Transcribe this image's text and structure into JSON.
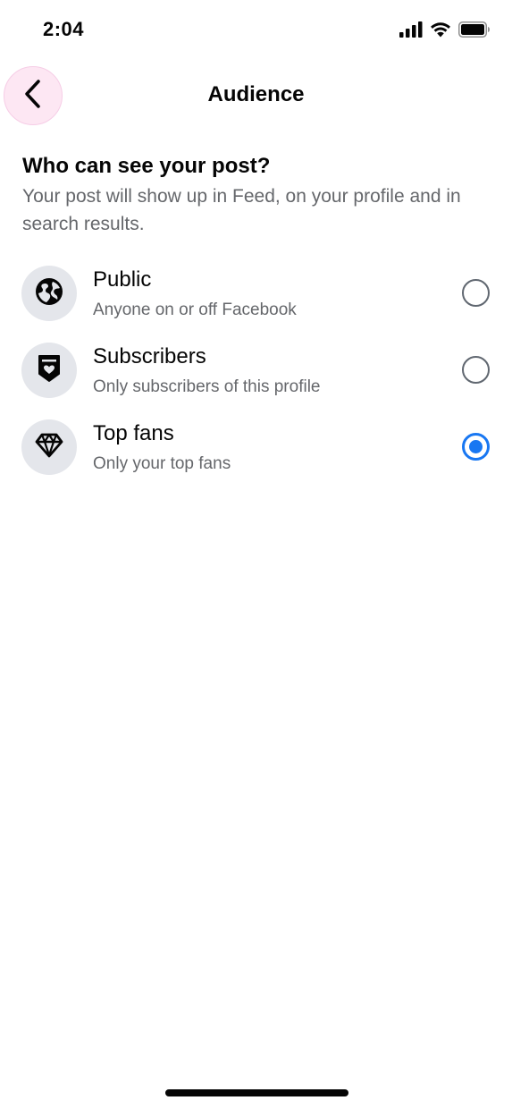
{
  "status_bar": {
    "time": "2:04"
  },
  "header": {
    "title": "Audience",
    "back_icon": "chevron-left-icon"
  },
  "intro": {
    "question": "Who can see your post?",
    "description": "Your post will show up in Feed, on your profile and in search results."
  },
  "options": [
    {
      "label": "Public",
      "sublabel": "Anyone on or off Facebook",
      "icon": "globe-icon",
      "selected": false
    },
    {
      "label": "Subscribers",
      "sublabel": "Only subscribers of this profile",
      "icon": "subscriber-badge-icon",
      "selected": false
    },
    {
      "label": "Top fans",
      "sublabel": "Only your top fans",
      "icon": "diamond-icon",
      "selected": true
    }
  ],
  "colors": {
    "accent": "#1877f2",
    "back_button_bg": "#fde7f3",
    "icon_bg": "#e4e6eb",
    "secondary_text": "#65676b"
  }
}
